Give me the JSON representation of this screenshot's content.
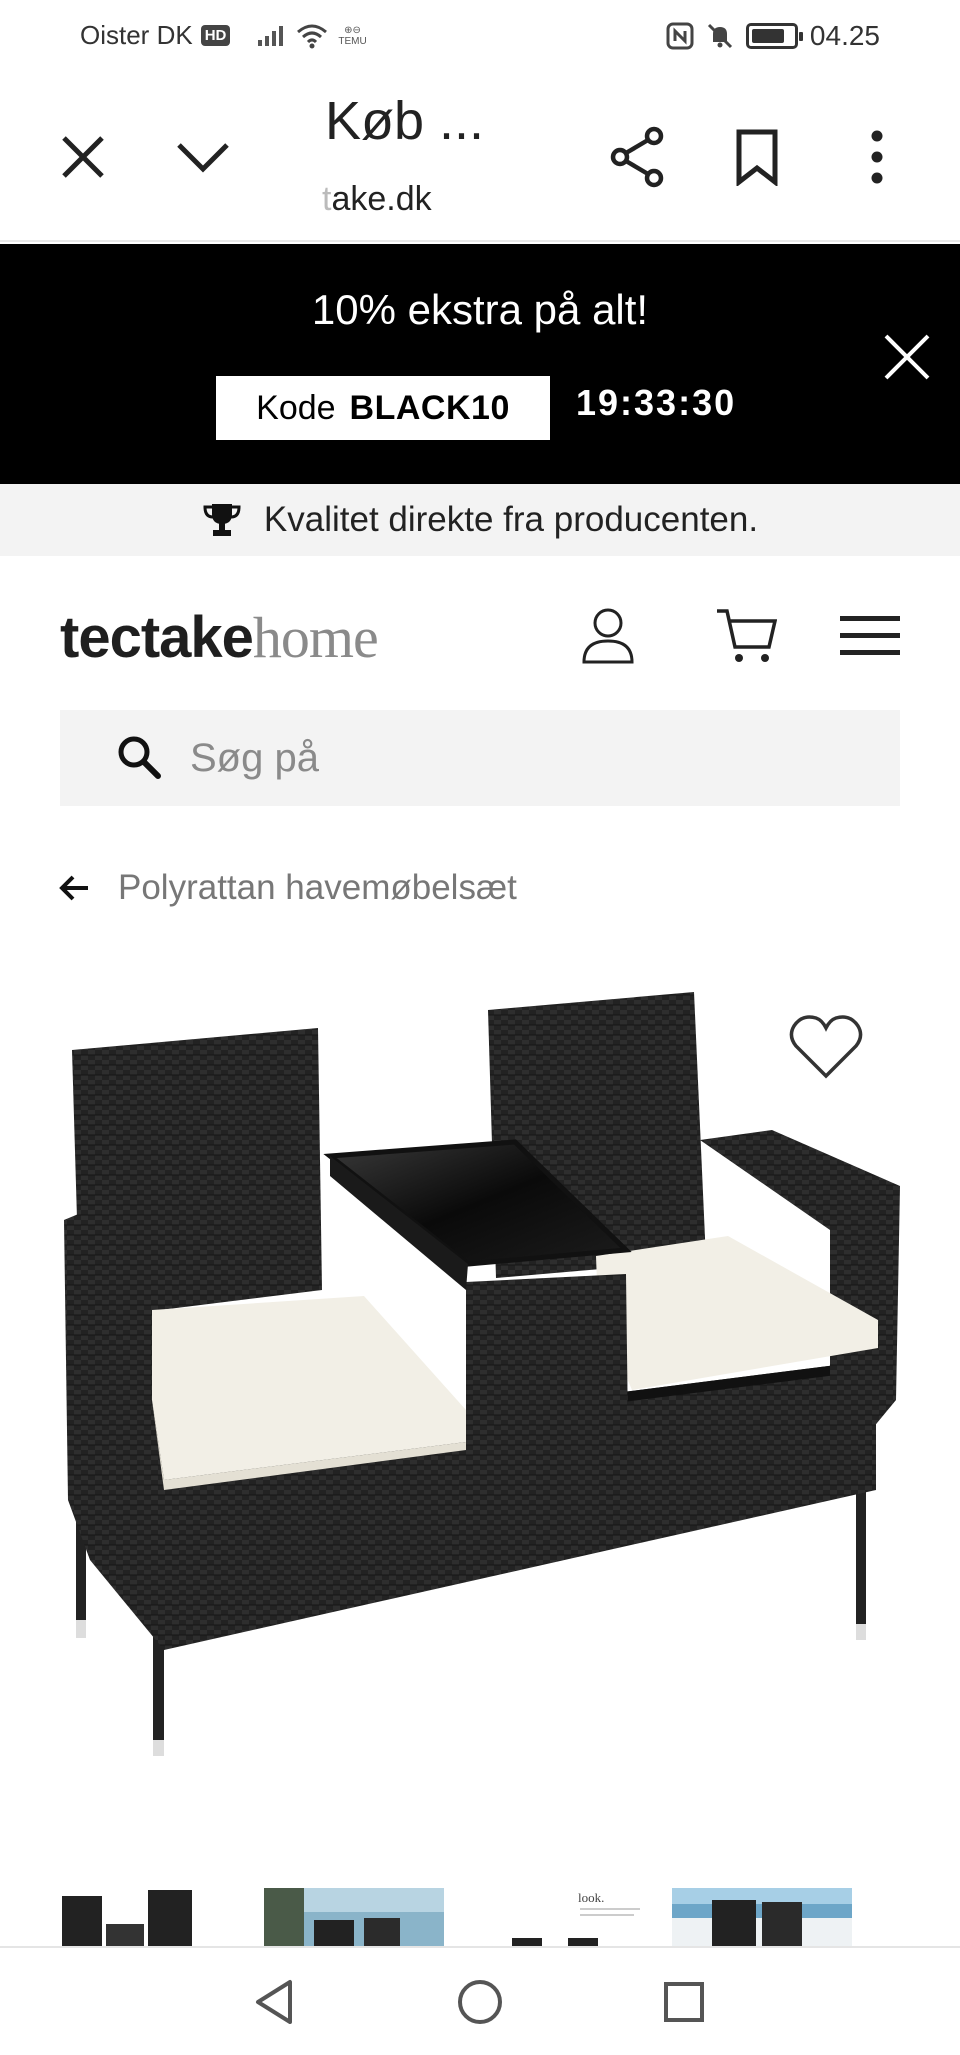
{
  "status_bar": {
    "carrier": "Oister DK",
    "hd_badge": "HD",
    "temu_label": "TEMU",
    "time": "04.25",
    "battery_level": 0.8
  },
  "browser": {
    "page_title": "Køb ...",
    "url_faded": "t",
    "url_visible": "ake.dk",
    "icons": [
      "close-icon",
      "chevron-down-icon",
      "share-icon",
      "bookmark-icon",
      "more-vertical-icon"
    ]
  },
  "promo": {
    "headline": "10% ekstra på alt!",
    "code_label": "Kode",
    "code_value": "BLACK10",
    "countdown": "19:33:30"
  },
  "usp": {
    "icon": "trophy-icon",
    "text": "Kvalitet direkte fra producenten."
  },
  "header": {
    "logo_bold": "tectake",
    "logo_light": "home",
    "icons": [
      "account-icon",
      "cart-icon",
      "menu-icon"
    ]
  },
  "search": {
    "placeholder": "Søg på",
    "value": ""
  },
  "breadcrumb": {
    "back_label": "Polyrattan havemøbelsæt"
  },
  "product": {
    "image_alt": "Rattan bench with table",
    "thumb_caption": "look.",
    "thumbnail_count": 5
  },
  "nav": {
    "icons": [
      "back-triangle-icon",
      "home-circle-icon",
      "recents-square-icon"
    ]
  },
  "colors": {
    "promo_bg": "#000000",
    "usp_bg": "#f3f3f3",
    "search_bg": "#f3f3f3",
    "rattan": "#222222",
    "cushion": "#f2efe6"
  }
}
